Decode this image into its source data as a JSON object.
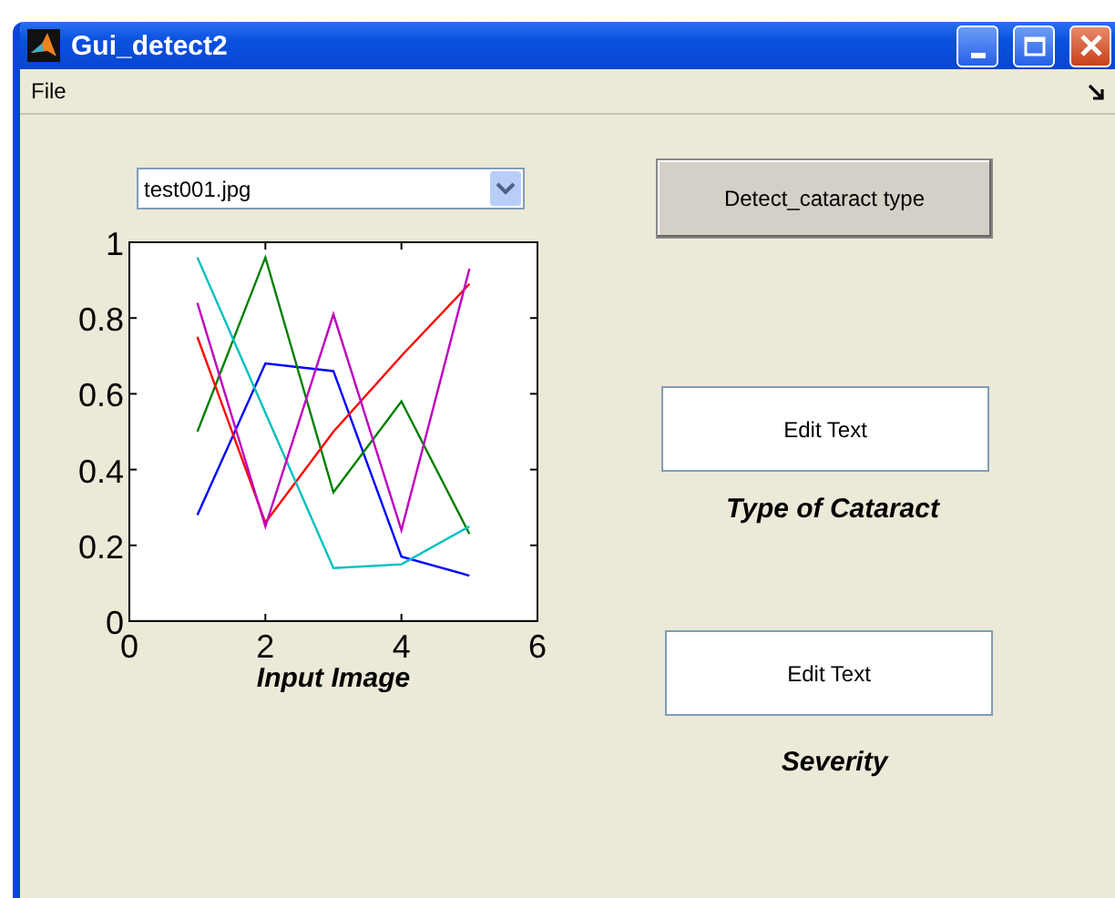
{
  "window": {
    "title": "Gui_detect2"
  },
  "menu": [
    "File"
  ],
  "popup": {
    "value": "test001.jpg"
  },
  "detect_button": "Detect_cataract type",
  "type_field": {
    "value": "Edit Text",
    "label": "Type of Cataract"
  },
  "severity_field": {
    "value": "Edit Text",
    "label": "Severity"
  },
  "axes": {
    "chart_data": {
      "type": "line",
      "xlabel": "Input Image",
      "xlim": [
        0,
        6
      ],
      "ylim": [
        0,
        1
      ],
      "xticks": [
        0,
        2,
        4,
        6
      ],
      "yticks": [
        0,
        0.2,
        0.4,
        0.6,
        0.8,
        1
      ],
      "x": [
        1,
        2,
        3,
        4,
        5
      ],
      "series": [
        {
          "color": "#0000ff",
          "values": [
            0.28,
            0.68,
            0.66,
            0.17,
            0.12
          ]
        },
        {
          "color": "#008000",
          "values": [
            0.5,
            0.96,
            0.34,
            0.58,
            0.23
          ]
        },
        {
          "color": "#ff0000",
          "values": [
            0.75,
            0.26,
            0.5,
            0.7,
            0.89
          ]
        },
        {
          "color": "#00bfbf",
          "values": [
            0.96,
            0.55,
            0.14,
            0.15,
            0.25
          ]
        },
        {
          "color": "#bf00bf",
          "values": [
            0.84,
            0.25,
            0.81,
            0.24,
            0.93
          ]
        }
      ]
    }
  }
}
